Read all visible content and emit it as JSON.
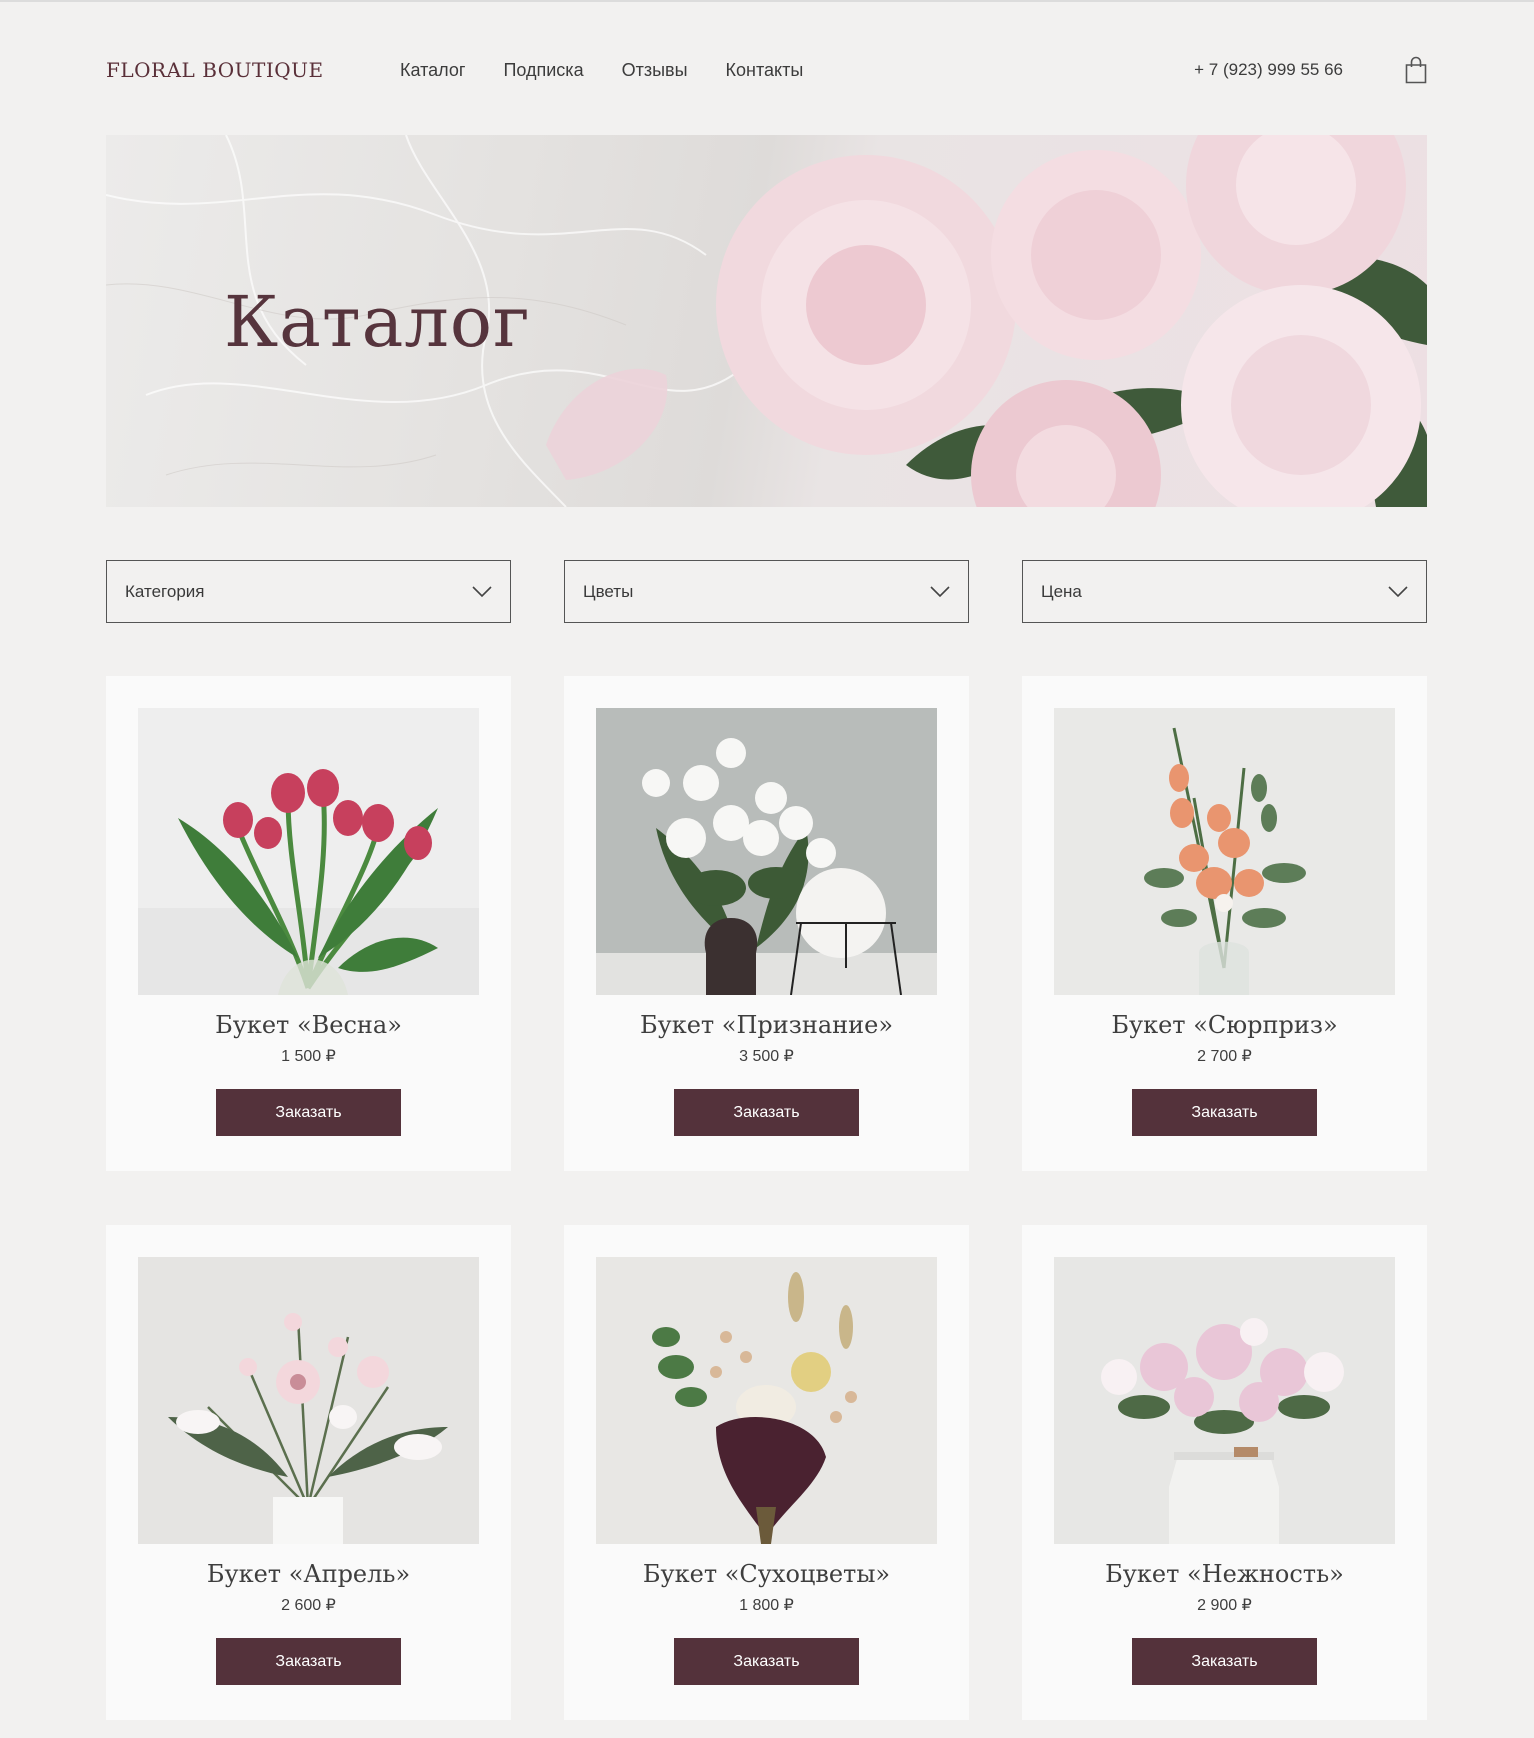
{
  "header": {
    "logo": "FLORAL BOUTIQUE",
    "nav": [
      "Каталог",
      "Подписка",
      "Отзывы",
      "Контакты"
    ],
    "phone": "+ 7 (923) 999 55 66",
    "cart_icon": "shopping-bag-icon"
  },
  "hero": {
    "title": "Каталог"
  },
  "filters": [
    {
      "label": "Категория",
      "icon": "chevron-down-icon"
    },
    {
      "label": "Цветы",
      "icon": "chevron-down-icon"
    },
    {
      "label": "Цена",
      "icon": "chevron-down-icon"
    }
  ],
  "products": [
    {
      "title": "Букет «Весна»",
      "price": "1 500 ₽",
      "button": "Заказать"
    },
    {
      "title": "Букет «Признание»",
      "price": "3 500 ₽",
      "button": "Заказать"
    },
    {
      "title": "Букет «Сюрприз»",
      "price": "2 700 ₽",
      "button": "Заказать"
    },
    {
      "title": "Букет «Апрель»",
      "price": "2 600 ₽",
      "button": "Заказать"
    },
    {
      "title": "Букет «Сухоцветы»",
      "price": "1 800 ₽",
      "button": "Заказать"
    },
    {
      "title": "Букет «Нежность»",
      "price": "2 900 ₽",
      "button": "Заказать"
    }
  ],
  "colors": {
    "background": "#f2f1f0",
    "card": "#fafafa",
    "accent": "#54323b",
    "logo": "#5a3039"
  }
}
